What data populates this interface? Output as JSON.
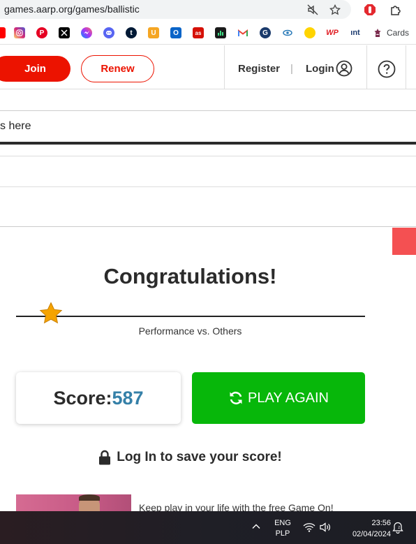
{
  "browser": {
    "url": "games.aarp.org/games/ballistic",
    "icons": [
      "mute-tab-icon",
      "bookmark-star-icon",
      "adblock-extension-icon",
      "extensions-icon"
    ]
  },
  "bookmarks": {
    "icons": [
      "youtube-icon",
      "instagram-icon",
      "pinterest-icon",
      "x-icon",
      "messenger-icon",
      "discord-icon",
      "tumblr-icon",
      "u-app-icon",
      "outlook-icon",
      "lastfm-icon",
      "stats-icon",
      "gmail-icon",
      "news-icon",
      "link-icon",
      "yellow-dot-icon",
      "wp-icon",
      "int-icon",
      "cards-icon"
    ],
    "wp_label": "WP",
    "int_label": "ınt",
    "cards_label": "Cards"
  },
  "header": {
    "join_label": "Join",
    "renew_label": "Renew",
    "register_label": "Register",
    "separator": "|",
    "login_label": "Login",
    "accent_color": "#ec1300"
  },
  "search": {
    "text": "s here"
  },
  "result": {
    "title": "Congratulations!",
    "performance_label": "Performance vs. Others",
    "performance_fraction": 0.1,
    "score_label": "Score:",
    "score_value": "587",
    "play_again_label": "PLAY AGAIN",
    "save_text": "Log In to save your score!",
    "play_color": "#07b70a",
    "score_color": "#3580a8"
  },
  "promo": {
    "text": "Keep play in your life with the free Game On!"
  },
  "taskbar": {
    "lang_top": "ENG",
    "lang_bottom": "PLP",
    "time": "23:56",
    "date": "02/04/2024"
  }
}
